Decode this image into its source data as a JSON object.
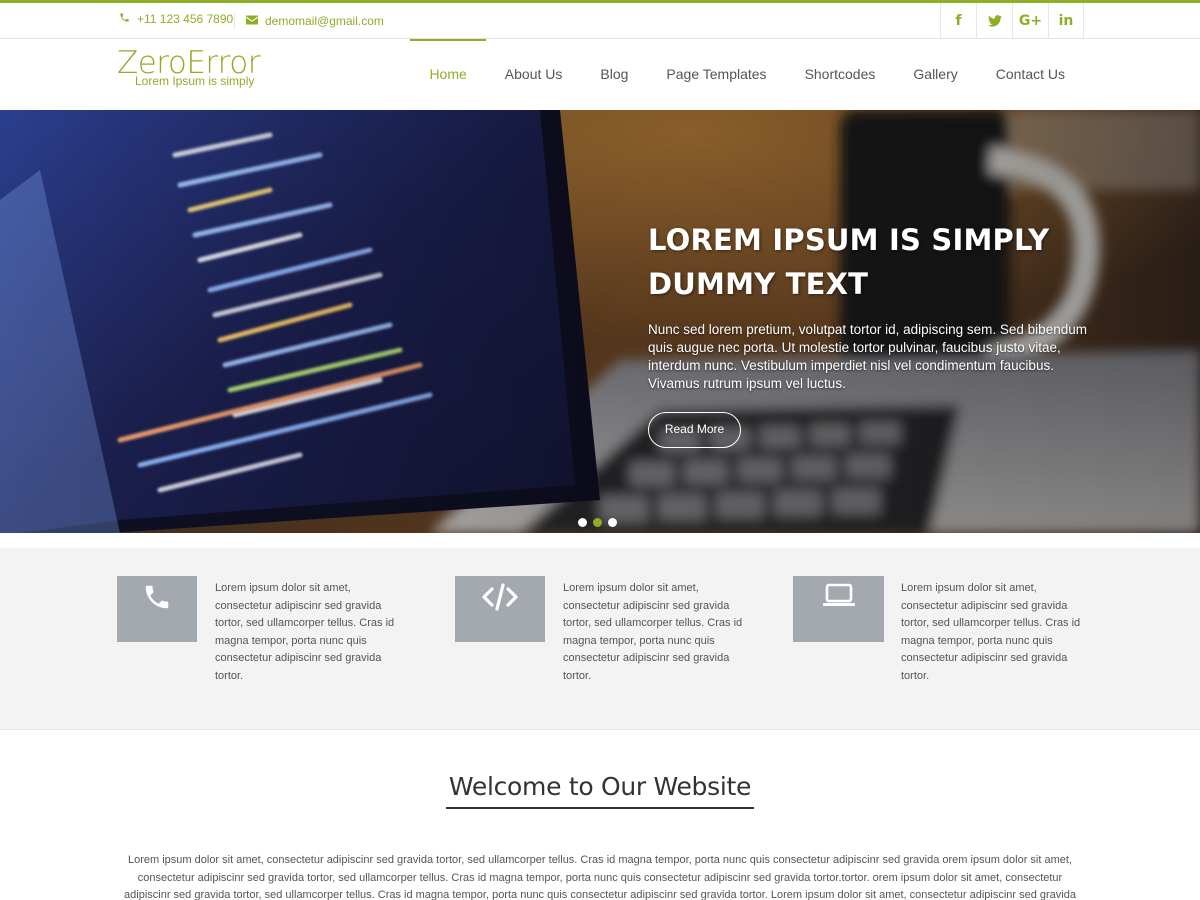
{
  "topbar": {
    "phone": "+11 123 456 7890",
    "email": "demomail@gmail.com",
    "social": [
      {
        "icon": "facebook-icon",
        "glyph": "f"
      },
      {
        "icon": "twitter-icon",
        "glyph": "🐦"
      },
      {
        "icon": "google-plus-icon",
        "glyph": "G+"
      },
      {
        "icon": "linkedin-icon",
        "glyph": "in"
      }
    ]
  },
  "header": {
    "logo_title": "ZeroError",
    "logo_tagline": "Lorem Ipsum is simply",
    "nav": [
      "Home",
      "About Us",
      "Blog",
      "Page Templates",
      "Shortcodes",
      "Gallery",
      "Contact Us"
    ],
    "active_nav": "Home"
  },
  "hero": {
    "title": "LOREM IPSUM IS SIMPLY DUMMY TEXT",
    "text": "Nunc sed lorem pretium, volutpat tortor id, adipiscing sem. Sed bibendum quis augue nec porta. Ut molestie tortor pulvinar, faucibus justo vitae, interdum nunc. Vestibulum imperdiet nisl vel condimentum faucibus. Vivamus rutrum ipsum vel luctus.",
    "button": "Read More",
    "slides": 3,
    "active_slide": 2
  },
  "features": [
    {
      "icon": "phone-icon",
      "text": "Lorem ipsum dolor sit amet, consectetur adipiscinr sed gravida tortor, sed ullamcorper tellus. Cras id magna tempor, porta nunc quis consectetur adipiscinr sed gravida tortor."
    },
    {
      "icon": "code-icon",
      "text": "Lorem ipsum dolor sit amet, consectetur adipiscinr sed gravida tortor, sed ullamcorper tellus. Cras id magna tempor, porta nunc quis consectetur adipiscinr sed gravida tortor."
    },
    {
      "icon": "laptop-icon",
      "text": "Lorem ipsum dolor sit amet, consectetur adipiscinr sed gravida tortor, sed ullamcorper tellus. Cras id magna tempor, porta nunc quis consectetur adipiscinr sed gravida tortor."
    }
  ],
  "welcome": {
    "title": "Welcome to Our Website",
    "text": "Lorem ipsum dolor sit amet, consectetur adipiscinr sed gravida tortor, sed ullamcorper tellus. Cras id magna tempor, porta nunc quis consectetur adipiscinr sed gravida orem ipsum dolor sit amet, consectetur adipiscinr sed gravida tortor, sed ullamcorper tellus. Cras id magna tempor, porta nunc quis consectetur adipiscinr sed gravida tortor.tortor. orem ipsum dolor sit amet, consectetur adipiscinr sed gravida tortor, sed ullamcorper tellus. Cras id magna tempor, porta nunc quis consectetur adipiscinr sed gravida tortor. Lorem ipsum dolor sit amet, consectetur adipiscinr sed gravida"
  },
  "colors": {
    "accent": "#8dae25",
    "feature_box": "#a4a9b0",
    "feature_bg": "#f3f3f3"
  }
}
